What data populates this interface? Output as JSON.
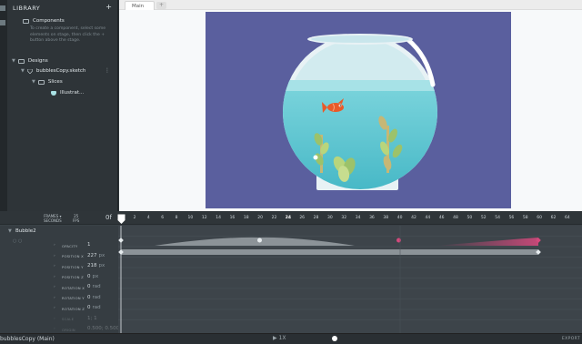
{
  "library": {
    "title": "LIBRARY",
    "add": "+",
    "components": "Components",
    "help": "To create a component, select some elements on stage, then click the + button above the stage.",
    "designs": "Designs",
    "file": "bubblesCopy.sketch",
    "slices": "Slices",
    "illustration": "Illustrat..."
  },
  "stage": {
    "tab": "Main",
    "tab_add": "+"
  },
  "timeline": {
    "hdr_frames": "FRAMES",
    "hdr_seconds": "SECONDS",
    "hdr_fps": "25",
    "hdr_fps_unit": "FPS",
    "current": "0f",
    "ticks": [
      "2",
      "4",
      "6",
      "8",
      "10",
      "12",
      "14",
      "16",
      "18",
      "20",
      "22",
      "24",
      "26",
      "28",
      "30",
      "32",
      "34",
      "36",
      "38",
      "40",
      "42",
      "44",
      "46",
      "48",
      "50",
      "52",
      "54",
      "56",
      "58",
      "60",
      "62",
      "64"
    ],
    "layer": "Bubble2",
    "props": [
      {
        "name": "OPACITY",
        "value": "1",
        "unit": ""
      },
      {
        "name": "POSITION X",
        "value": "227",
        "unit": "px"
      },
      {
        "name": "POSITION Y",
        "value": "218",
        "unit": "px"
      },
      {
        "name": "POSITION Z",
        "value": "0",
        "unit": "px"
      },
      {
        "name": "ROTATION X",
        "value": "0",
        "unit": "rad"
      },
      {
        "name": "ROTATION Y",
        "value": "0",
        "unit": "rad"
      },
      {
        "name": "ROTATION Z",
        "value": "0",
        "unit": "rad"
      },
      {
        "name": "SCALE",
        "value": "1; 1",
        "unit": ""
      },
      {
        "name": "ORIGIN",
        "value": "0.500; 0.500",
        "unit": ""
      },
      {
        "name": "STYLE",
        "value": "{...}",
        "unit": ""
      }
    ]
  },
  "status": {
    "name": "bubblesCopy (Main)",
    "controls": "▶  1X",
    "export": "EXPORT"
  },
  "colors": {
    "artboard": "#5a5f9e",
    "water": "#5cc5d0",
    "fish": "#e85a29",
    "keyframe_pink": "#d3497c"
  }
}
